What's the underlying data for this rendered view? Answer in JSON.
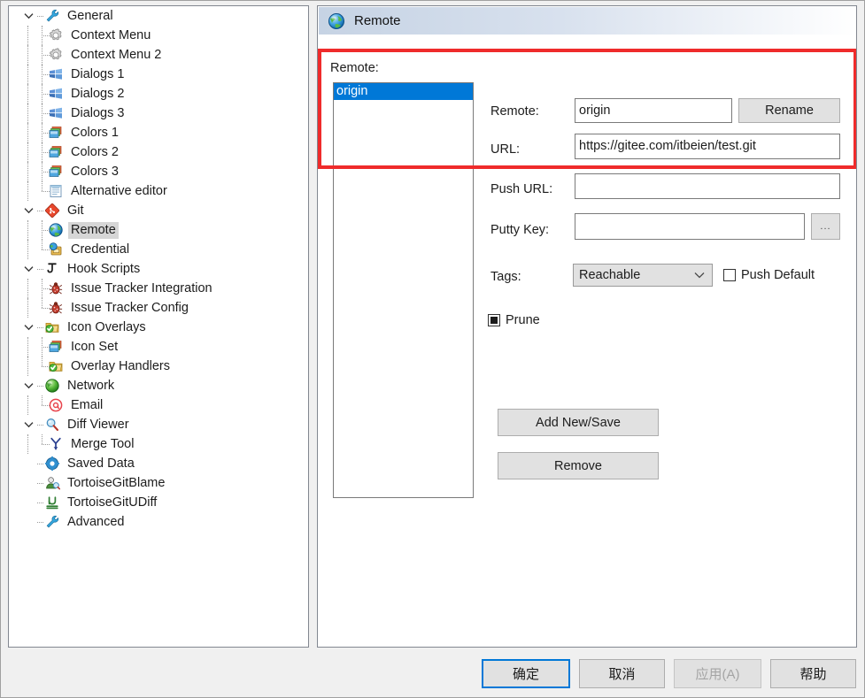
{
  "window": {
    "title": "Remote",
    "header_icon": "globe-icon"
  },
  "tree": {
    "items": [
      {
        "label": "General",
        "icon": "wrench-icon",
        "depth": 0,
        "expanded": true,
        "selected": false
      },
      {
        "label": "Context Menu",
        "icon": "gear-icon",
        "depth": 1,
        "selected": false
      },
      {
        "label": "Context Menu 2",
        "icon": "gear-icon",
        "depth": 1,
        "selected": false
      },
      {
        "label": "Dialogs 1",
        "icon": "windows-icon",
        "depth": 1,
        "selected": false
      },
      {
        "label": "Dialogs 2",
        "icon": "windows-icon",
        "depth": 1,
        "selected": false
      },
      {
        "label": "Dialogs 3",
        "icon": "windows-icon",
        "depth": 1,
        "selected": false
      },
      {
        "label": "Colors 1",
        "icon": "colors-icon",
        "depth": 1,
        "selected": false
      },
      {
        "label": "Colors 2",
        "icon": "colors-icon",
        "depth": 1,
        "selected": false
      },
      {
        "label": "Colors 3",
        "icon": "colors-icon",
        "depth": 1,
        "selected": false
      },
      {
        "label": "Alternative editor",
        "icon": "notepad-icon",
        "depth": 1,
        "selected": false
      },
      {
        "label": "Git",
        "icon": "git-icon",
        "depth": 0,
        "expanded": true,
        "selected": false
      },
      {
        "label": "Remote",
        "icon": "globe-icon",
        "depth": 1,
        "selected": true
      },
      {
        "label": "Credential",
        "icon": "credential-icon",
        "depth": 1,
        "selected": false
      },
      {
        "label": "Hook Scripts",
        "icon": "hook-icon",
        "depth": 0,
        "expanded": true,
        "selected": false
      },
      {
        "label": "Issue Tracker Integration",
        "icon": "bug-icon",
        "depth": 1,
        "selected": false
      },
      {
        "label": "Issue Tracker Config",
        "icon": "bug-icon",
        "depth": 1,
        "selected": false
      },
      {
        "label": "Icon Overlays",
        "icon": "folder-check-icon",
        "depth": 0,
        "expanded": true,
        "selected": false
      },
      {
        "label": "Icon Set",
        "icon": "colors-icon",
        "depth": 1,
        "selected": false
      },
      {
        "label": "Overlay Handlers",
        "icon": "folder-check-icon",
        "depth": 1,
        "selected": false
      },
      {
        "label": "Network",
        "icon": "globe-green-icon",
        "depth": 0,
        "expanded": true,
        "selected": false
      },
      {
        "label": "Email",
        "icon": "at-icon",
        "depth": 1,
        "selected": false
      },
      {
        "label": "Diff Viewer",
        "icon": "magnifier-icon",
        "depth": 0,
        "expanded": true,
        "selected": false
      },
      {
        "label": "Merge Tool",
        "icon": "merge-icon",
        "depth": 1,
        "selected": false
      },
      {
        "label": "Saved Data",
        "icon": "gear-blue-icon",
        "depth": 0,
        "selected": false
      },
      {
        "label": "TortoiseGitBlame",
        "icon": "blame-icon",
        "depth": 0,
        "selected": false
      },
      {
        "label": "TortoiseGitUDiff",
        "icon": "udiff-icon",
        "depth": 0,
        "selected": false
      },
      {
        "label": "Advanced",
        "icon": "wrench-icon",
        "depth": 0,
        "selected": false
      }
    ]
  },
  "remote_page": {
    "group_label": "Remote:",
    "list": {
      "items": [
        "origin"
      ],
      "selected_index": 0
    },
    "fields": {
      "remote_label": "Remote:",
      "remote_value": "origin",
      "url_label": "URL:",
      "url_value": "https://gitee.com/itbeien/test.git",
      "push_url_label": "Push URL:",
      "push_url_value": "",
      "putty_key_label": "Putty Key:",
      "putty_key_value": "",
      "browse_label": "...",
      "tags_label": "Tags:",
      "tags_value": "Reachable",
      "push_default_label": "Push Default",
      "push_default_checked": false,
      "prune_label": "Prune",
      "prune_state": "indeterminate"
    },
    "buttons": {
      "rename": "Rename",
      "add_new_save": "Add New/Save",
      "remove": "Remove"
    }
  },
  "dialog_buttons": {
    "ok": "确定",
    "cancel": "取消",
    "apply": "应用(A)",
    "help": "帮助"
  },
  "colors": {
    "selection_blue": "#0078d7",
    "annotation_red": "#ef2b2b",
    "button_face": "#e1e1e1",
    "dialog_face": "#f0f0f0"
  }
}
